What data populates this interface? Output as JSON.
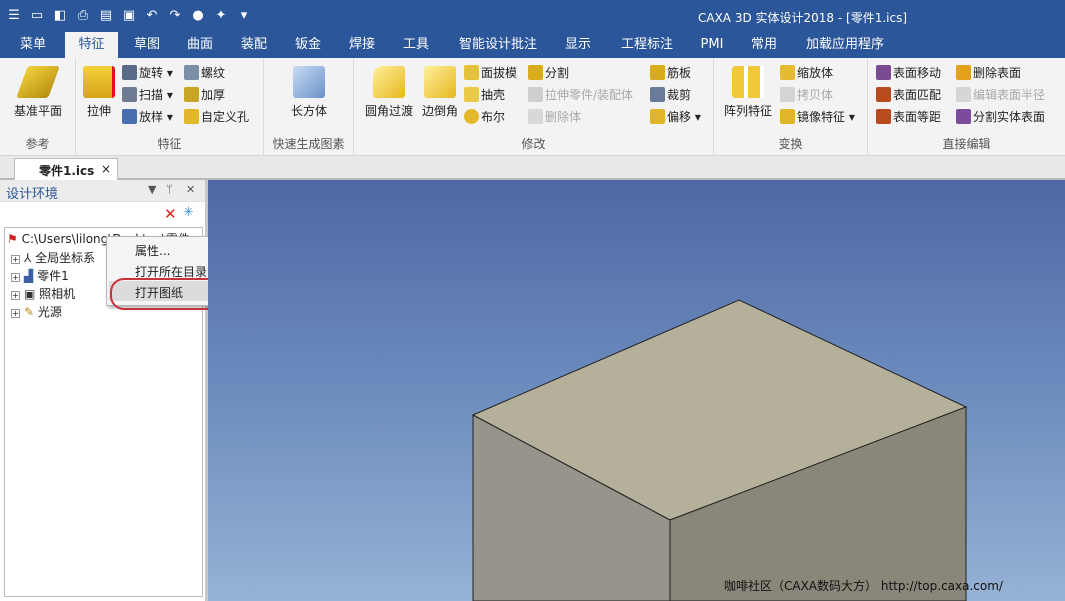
{
  "window": {
    "title": "CAXA 3D 实体设计2018 - [零件1.ics]"
  },
  "quick_access": [
    "layers-icon",
    "new-file-icon",
    "open-icon",
    "print-preview-icon",
    "folder-icon",
    "save-icon",
    "undo-icon",
    "redo-icon",
    "material-icon",
    "sparkle-icon",
    "dropdown-arrow-icon"
  ],
  "menu": {
    "tabs": [
      "菜单",
      "特征",
      "草图",
      "曲面",
      "装配",
      "钣金",
      "焊接",
      "工具",
      "智能设计批注",
      "显示",
      "工程标注",
      "PMI",
      "常用",
      "加载应用程序"
    ],
    "active": "特征"
  },
  "ribbon": {
    "reference": {
      "label": "参考",
      "base_plane": "基准平面"
    },
    "feature": {
      "label": "特征",
      "extrude": "拉伸",
      "revolve": "旋转",
      "sweep": "扫描",
      "loft": "放样",
      "thread": "螺纹",
      "thicken": "加厚",
      "custom_hole": "自定义孔"
    },
    "quick": {
      "label": "快速生成图素",
      "box": "长方体"
    },
    "modify": {
      "label": "修改",
      "fillet": "圆角过渡",
      "chamfer": "边倒角",
      "draft": "面拔模",
      "shell": "抽壳",
      "boolean": "布尔",
      "split": "分割",
      "extrude_part": "拉伸零件/装配体",
      "delete_body": "删除体",
      "rib": "筋板",
      "trim": "裁剪",
      "offset": "偏移"
    },
    "transform": {
      "label": "变换",
      "array": "阵列特征",
      "scale": "缩放体",
      "copy": "拷贝体",
      "mirror": "镜像特征"
    },
    "direct": {
      "label": "直接编辑",
      "move_face": "表面移动",
      "match_face": "表面匹配",
      "equidistant": "表面等距",
      "delete_face": "删除表面",
      "edit_radius": "编辑表面半径",
      "split_face": "分割实体表面"
    }
  },
  "document_tab": {
    "label": "零件1.ics",
    "close": "×"
  },
  "panel": {
    "title": "设计环境",
    "path": "C:\\Users\\lilong\\Desktop\\零件",
    "tree": [
      {
        "label": "全局坐标系"
      },
      {
        "label": "零件1"
      },
      {
        "label": "照相机"
      },
      {
        "label": "光源"
      }
    ]
  },
  "context_menu": {
    "items": [
      "属性...",
      "打开所在目录",
      "打开图纸"
    ],
    "highlighted": "打开图纸"
  },
  "watermark": "咖啡社区（CAXA数码大方） http://top.caxa.com/",
  "colors": {
    "title_bar": "#2b579a",
    "ribbon_bg": "#f3f3f3",
    "viewport_top": "#4f68a4",
    "viewport_bottom": "#96b2d4",
    "box_top": "#b5b09a",
    "box_left": "#97948b",
    "box_right": "#8a8679",
    "annotation": "#c8323a"
  }
}
